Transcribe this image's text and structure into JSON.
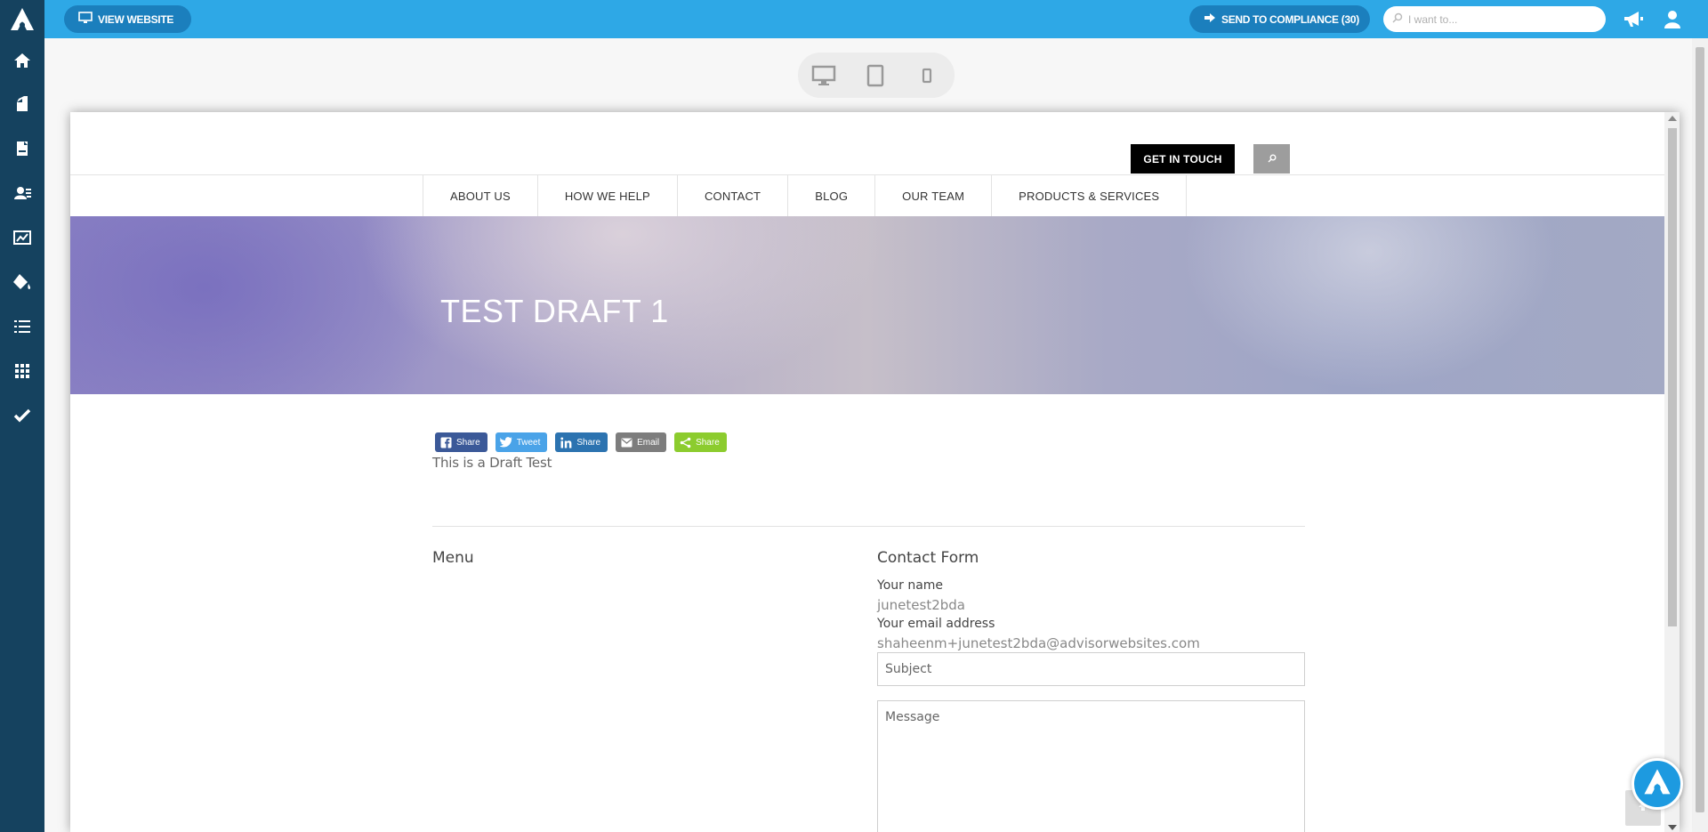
{
  "topbar": {
    "view_website_label": "VIEW WEBSITE",
    "send_compliance_label": "SEND TO COMPLIANCE (30)",
    "search_placeholder": "I want to..."
  },
  "sidebar": {
    "items": [
      {
        "icon": "home-icon"
      },
      {
        "icon": "pages-icon"
      },
      {
        "icon": "document-icon"
      },
      {
        "icon": "contacts-icon"
      },
      {
        "icon": "analytics-icon"
      },
      {
        "icon": "paint-bucket-icon"
      },
      {
        "icon": "list-icon"
      },
      {
        "icon": "apps-grid-icon"
      },
      {
        "icon": "checkmark-icon"
      }
    ]
  },
  "site": {
    "get_in_touch_label": "GET IN TOUCH",
    "nav": [
      "ABOUT US",
      "HOW WE HELP",
      "CONTACT",
      "BLOG",
      "OUR TEAM",
      "PRODUCTS & SERVICES"
    ],
    "hero_title": "TEST DRAFT 1",
    "share_buttons": [
      {
        "label": "Share",
        "network": "facebook",
        "color": "#3b5998"
      },
      {
        "label": "Tweet",
        "network": "twitter",
        "color": "#4aa3e8"
      },
      {
        "label": "Share",
        "network": "linkedin",
        "color": "#2c73b0"
      },
      {
        "label": "Email",
        "network": "email",
        "color": "#7d7d7d"
      },
      {
        "label": "Share",
        "network": "sharethis",
        "color": "#8ccc2e"
      }
    ],
    "body_text": "This is a Draft Test",
    "menu_heading": "Menu",
    "contact_form": {
      "heading": "Contact Form",
      "name_label": "Your name",
      "name_value": "junetest2bda",
      "email_label": "Your email address",
      "email_value": "shaheenm+junetest2bda@advisorwebsites.com",
      "subject_placeholder": "Subject",
      "message_placeholder": "Message"
    }
  },
  "colors": {
    "sidebar": "#15425f",
    "topbar": "#2ea8e6",
    "topbar_pill": "#1b7fbd"
  }
}
